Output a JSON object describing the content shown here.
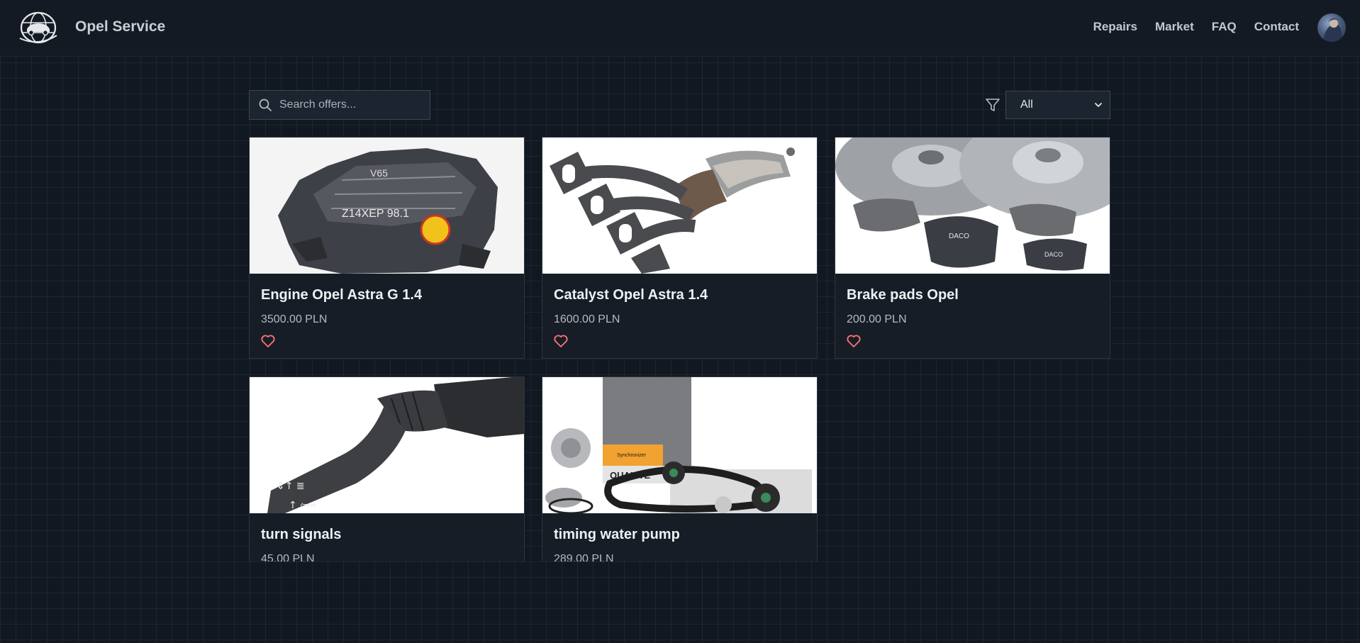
{
  "app": {
    "brand": "Opel Service",
    "logo_icon": "globe-car-logo-icon",
    "avatar_icon": "user-avatar"
  },
  "nav": {
    "items": [
      "Repairs",
      "Market",
      "FAQ",
      "Contact"
    ]
  },
  "toolbar": {
    "search_placeholder": "Search offers...",
    "search_value": "",
    "filter_icon": "filter-icon",
    "filter_selected": "All"
  },
  "offers": [
    {
      "title": "Engine Opel Astra G 1.4",
      "price": "3500.00 PLN",
      "image": "engine"
    },
    {
      "title": "Catalyst Opel Astra 1.4",
      "price": "1600.00 PLN",
      "image": "exhaust-catalyst"
    },
    {
      "title": "Brake pads Opel",
      "price": "200.00 PLN",
      "image": "brake-discs-pads"
    },
    {
      "title": "turn signals",
      "price": "45.00 PLN",
      "image": "turn-signal-stalk"
    },
    {
      "title": "timing water pump",
      "price": "289.00 PLN",
      "image": "timing-belt-kit"
    }
  ],
  "colors": {
    "background": "#121821",
    "card": "#161d27",
    "heart": "#f87171",
    "text": "#e5e7eb"
  }
}
